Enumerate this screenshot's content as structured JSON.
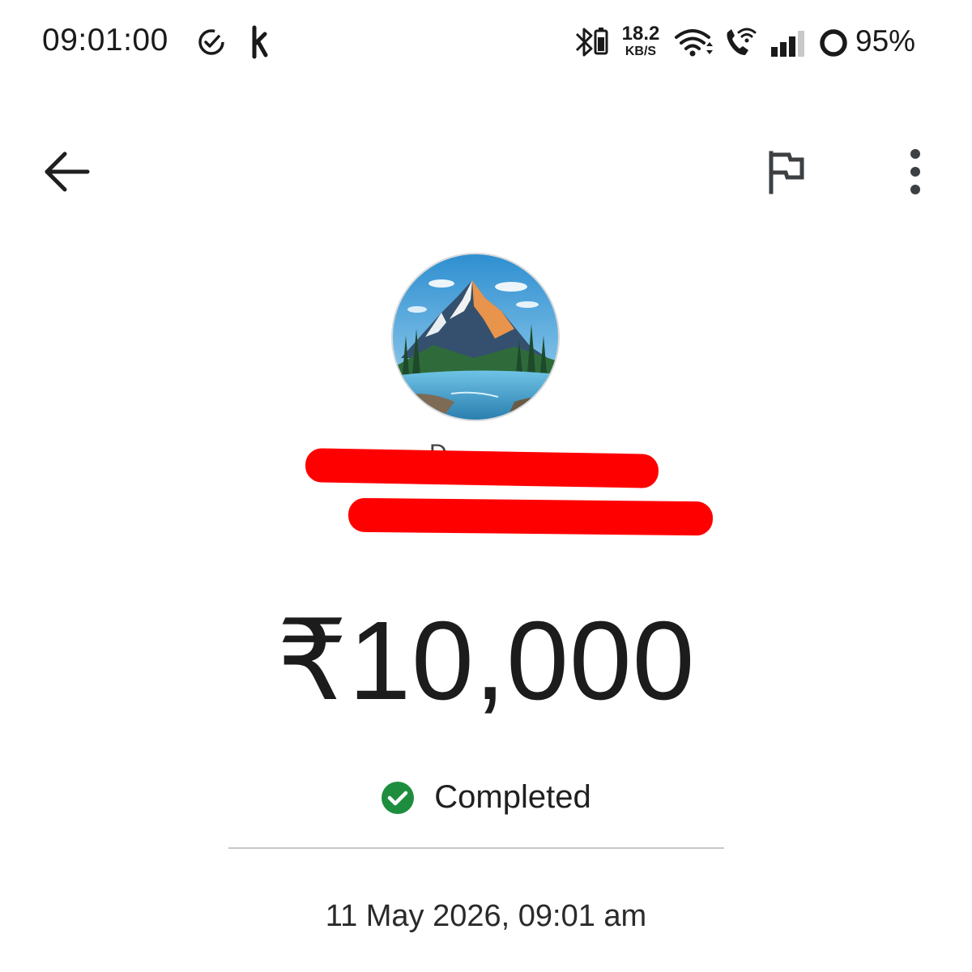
{
  "status_bar": {
    "time": "09:01:00",
    "left_icons": [
      "check-circle-icon",
      "app-k-icon"
    ],
    "network_speed_value": "18.2",
    "network_speed_unit": "KB/S",
    "right_icons": [
      "bluetooth-battery-icon",
      "wifi-icon",
      "wifi-call-icon",
      "signal-icon",
      "battery-ring-icon"
    ],
    "battery_percent": "95%"
  },
  "app_bar": {
    "back_icon": "arrow-back-icon",
    "flag_icon": "flag-icon",
    "more_icon": "more-vert-icon"
  },
  "payee": {
    "avatar": "mountain-lake-avatar",
    "name_visible_fragment": "D",
    "redaction_color": "#ff0000"
  },
  "payment": {
    "amount": "₹10,000",
    "status": "Completed",
    "status_color": "#1e8e3e",
    "datetime": "11 May 2026, 09:01 am"
  }
}
